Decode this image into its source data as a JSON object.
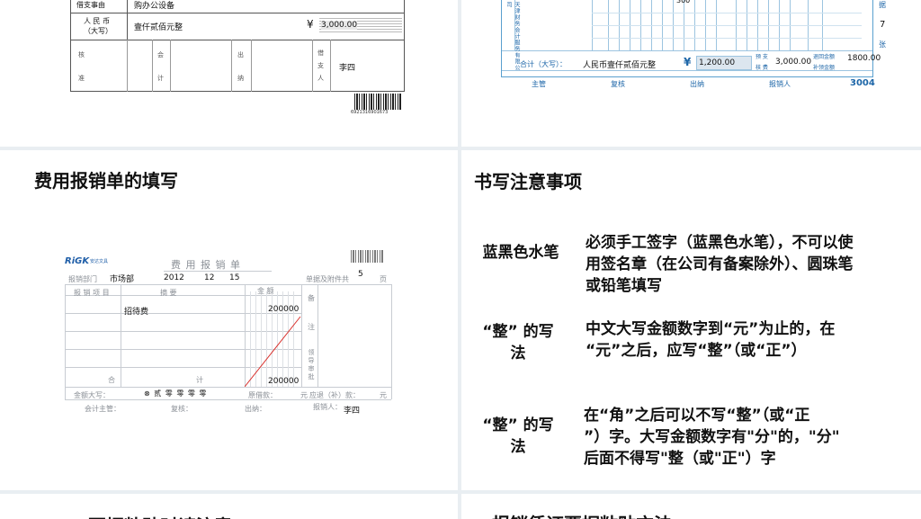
{
  "top_left_form": {
    "purpose_label": "借支事由",
    "purpose_value": "购办公设备",
    "amount_label_line1": "人 民 币",
    "amount_label_line2": "（大写）",
    "amount_words": "壹仟贰佰元整",
    "currency_symbol": "¥",
    "amount_number": "3,000.00",
    "approve_line1": "核",
    "approve_line2": "准",
    "accountant_line1": "会",
    "accountant_line2": "计",
    "cashier_line1": "出",
    "cashier_line2": "纳",
    "borrower_line1": "借",
    "borrower_line2": "支",
    "borrower_line3": "人",
    "borrower_name": "李四",
    "barcode_number": "6921316901673"
  },
  "top_right_form": {
    "row_number": "300",
    "total_label": "合计（大写）：",
    "total_words": "人民币壹仟贰佰元整",
    "currency_symbol": "¥",
    "total_number": "1,200.00",
    "advance_label_line1": "预 支",
    "advance_label_line2": "核 费",
    "advance_amount": "3,000.00",
    "refund_label_line1": "退回金额",
    "refund_label_line2": "补领金额",
    "refund_amount": "1800.00",
    "side_char_1": "据",
    "side_number": "7",
    "side_char_2": "张",
    "footer_manager": "主管",
    "footer_review": "复核",
    "footer_cashier": "出纳",
    "footer_claimant": "报销人",
    "form_number": "3004",
    "vertical_text": "天津财务会计服务有限公司"
  },
  "left_section": {
    "title": "费用报销单的填写",
    "form": {
      "logo": "RiGK",
      "logo_small": "安达文具",
      "form_title": "费 用 报 销 单",
      "dept_label": "报销部门",
      "dept_value": "市场部",
      "year_value": "2012",
      "month_value": "12",
      "day_value": "15",
      "attach_label": "单据及附件共",
      "attach_value": "5",
      "attach_unit": "页",
      "col_item": "报 销 项 目",
      "col_summary": "摘      要",
      "col_amount": "金 额",
      "col_note": "备",
      "col_note2": "注",
      "item_value": "招待费",
      "amount_row1": "200000",
      "amount_total": "200000",
      "total_label_a": "合",
      "total_label_b": "计",
      "audit_note": "领导审批",
      "caps_label": "金额大写：",
      "caps_words": "⊗ 贰 零 零 零 零",
      "borrow_label": "原借款：",
      "refund_label": "应退（补）款：",
      "yuan": "元",
      "mgr_label": "会计主管：",
      "review_label": "复核：",
      "cashier_label": "出纳：",
      "claimant_label": "报销人：",
      "claimant_value": "李四"
    }
  },
  "right_section": {
    "title": "书写注意事项",
    "notes": [
      {
        "term": "蓝黑色水笔",
        "desc_lines": [
          "必须手工签字（蓝黑色水笔），不可以使",
          "用签名章（在公司有备案除外）、圆珠笔",
          "或铅笔填写"
        ]
      },
      {
        "term_lines": [
          "“整” 的写",
          "法"
        ],
        "desc_lines": [
          "中文大写金额数字到“元”为止的，在",
          "“元”之后，应写“整”（或“正”）"
        ]
      },
      {
        "term_lines": [
          "“整” 的写",
          "法"
        ],
        "desc_lines": [
          "在“角”之后可以不写“整”（或“正",
          "”）字。大写金额数字有\"分\"的，\"分\"",
          "后面不得写\"整（或\"正\"）字"
        ]
      }
    ]
  },
  "bottom": {
    "left_title": "票据粘贴时请注意",
    "right_title": "报销凭证票据粘贴方法"
  },
  "colors": {
    "divider": "#e9eef2",
    "form_blue": "#1d66a8",
    "form_red": "#d9302c"
  }
}
